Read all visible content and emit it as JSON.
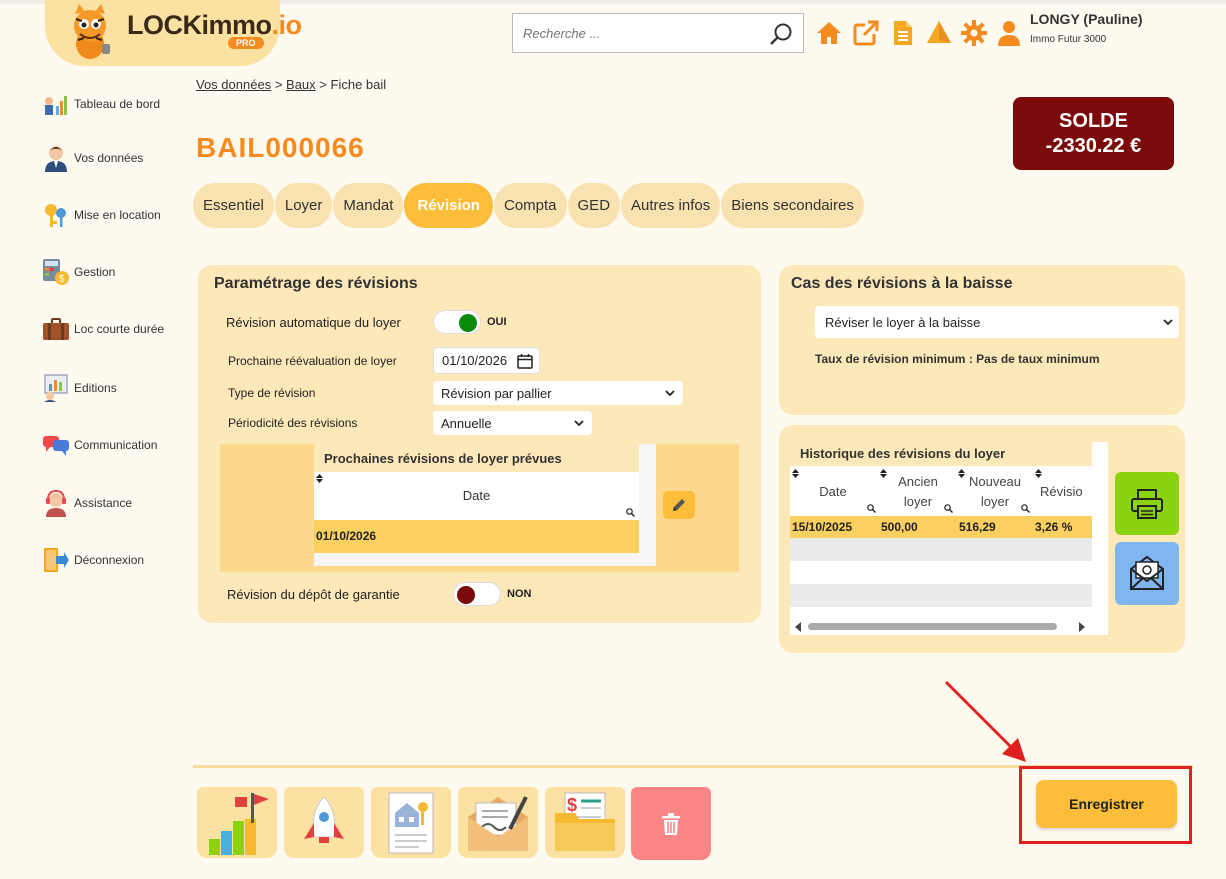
{
  "header": {
    "logo_text": "LOCKimmo",
    "logo_suffix": ".io",
    "logo_badge": "PRO",
    "search_placeholder": "Recherche ...",
    "user_name": "LONGY (Pauline)",
    "user_org": "Immo Futur 3000",
    "icons": [
      "home-icon",
      "external-link-icon",
      "document-icon",
      "alert-icon",
      "gear-icon",
      "user-icon"
    ]
  },
  "sidebar": {
    "items": [
      {
        "label": "Tableau de bord",
        "icon": "dashboard-icon"
      },
      {
        "label": "Vos données",
        "icon": "person-icon"
      },
      {
        "label": "Mise en location",
        "icon": "keys-icon"
      },
      {
        "label": "Gestion",
        "icon": "calculator-icon"
      },
      {
        "label": "Loc courte durée",
        "icon": "suitcase-icon"
      },
      {
        "label": "Editions",
        "icon": "report-icon"
      },
      {
        "label": "Communication",
        "icon": "chat-icon"
      },
      {
        "label": "Assistance",
        "icon": "headset-icon"
      },
      {
        "label": "Déconnexion",
        "icon": "logout-icon"
      }
    ]
  },
  "breadcrumb": {
    "item1": "Vos données",
    "sep": ">",
    "item2": "Baux",
    "item3": "Fiche bail"
  },
  "page": {
    "title": "BAIL000066",
    "solde_label": "SOLDE",
    "solde_value": "-2330.22 €"
  },
  "tabs": [
    "Essentiel",
    "Loyer",
    "Mandat",
    "Révision",
    "Compta",
    "GED",
    "Autres infos",
    "Biens secondaires"
  ],
  "active_tab": "Révision",
  "parametrage": {
    "title": "Paramétrage des révisions",
    "auto_label": "Révision automatique du loyer",
    "auto_value": "OUI",
    "next_label": "Prochaine réévaluation de loyer",
    "next_value": "01/10/2026",
    "type_label": "Type de révision",
    "type_value": "Révision par pallier",
    "period_label": "Périodicité des révisions",
    "period_value": "Annuelle",
    "table_title": "Prochaines révisions de loyer prévues",
    "table_col": "Date",
    "table_rows": [
      "01/10/2026"
    ],
    "depot_label": "Révision du dépôt de garantie",
    "depot_value": "NON"
  },
  "baisse": {
    "title": "Cas des révisions à la baisse",
    "select_value": "Réviser le loyer à la baisse",
    "taux_text": "Taux de révision minimum : Pas de taux minimum"
  },
  "historique": {
    "title": "Historique des révisions du loyer",
    "columns": [
      "Date",
      "Ancien loyer",
      "Nouveau loyer",
      "Révisio"
    ],
    "col_lines": [
      [
        "Date"
      ],
      [
        "Ancien",
        "loyer"
      ],
      [
        "Nouveau",
        "loyer"
      ],
      [
        "Révisio"
      ]
    ],
    "rows": [
      [
        "15/10/2025",
        "500,00",
        "516,29",
        "3,26 %"
      ]
    ]
  },
  "actions": {
    "save_label": "Enregistrer",
    "tiles": [
      "flag-chart-icon",
      "rocket-icon",
      "house-key-doc-icon",
      "envelope-sign-icon",
      "money-folder-icon",
      "trash-icon"
    ]
  },
  "colors": {
    "accent": "#f58b1f",
    "active_tab": "#fbbd3a",
    "panel": "#fce8b8",
    "solde_bg": "#7b0a0a",
    "toggle_on": "#0a8a0a",
    "toggle_off": "#7b0a0a"
  }
}
